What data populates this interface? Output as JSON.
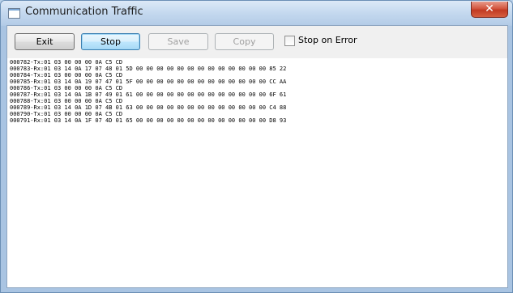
{
  "window": {
    "title": "Communication Traffic",
    "close_glyph": "✕"
  },
  "toolbar": {
    "exit_label": "Exit",
    "stop_label": "Stop",
    "save_label": "Save",
    "copy_label": "Copy",
    "stop_on_error_label": "Stop on Error",
    "stop_on_error_checked": false
  },
  "log": {
    "lines": [
      "000782-Tx:01 03 00 00 00 0A C5 CD",
      "000783-Rx:01 03 14 0A 17 07 48 01 5D 00 00 00 00 00 00 00 00 00 00 00 00 00 85 22",
      "000784-Tx:01 03 00 00 00 0A C5 CD",
      "000785-Rx:01 03 14 0A 19 07 47 01 5F 00 00 00 00 00 00 00 00 00 00 00 00 00 CC AA",
      "000786-Tx:01 03 00 00 00 0A C5 CD",
      "000787-Rx:01 03 14 0A 1B 07 49 01 61 00 00 00 00 00 00 00 00 00 00 00 00 00 6F 61",
      "000788-Tx:01 03 00 00 00 0A C5 CD",
      "000789-Rx:01 03 14 0A 1D 07 4B 01 63 00 00 00 00 00 00 00 00 00 00 00 00 00 C4 88",
      "000790-Tx:01 03 00 00 00 0A C5 CD",
      "000791-Rx:01 03 14 0A 1F 07 4D 01 65 00 00 00 00 00 00 00 00 00 00 00 00 00 D8 93"
    ]
  }
}
